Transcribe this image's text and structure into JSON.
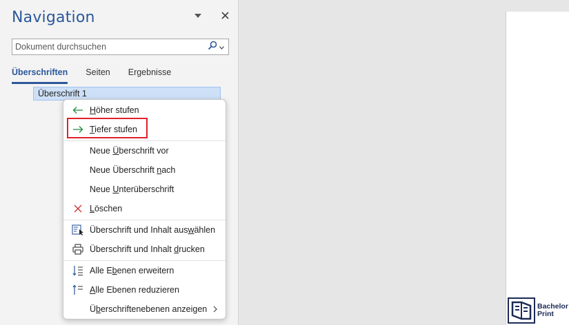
{
  "nav": {
    "title": "Navigation",
    "search_placeholder": "Dokument durchsuchen",
    "tabs": [
      {
        "label": "Überschriften",
        "active": true
      },
      {
        "label": "Seiten",
        "active": false
      },
      {
        "label": "Ergebnisse",
        "active": false
      }
    ],
    "selected_heading": "Überschrift 1"
  },
  "context_menu": {
    "items": [
      {
        "id": "promote",
        "icon": "arrow-left-icon",
        "pre": "",
        "key": "H",
        "post": "öher stufen"
      },
      {
        "id": "demote",
        "icon": "arrow-right-icon",
        "pre": "",
        "key": "T",
        "post": "iefer stufen"
      },
      {
        "id": "new-heading-before",
        "icon": "",
        "pre": "Neue ",
        "key": "Ü",
        "post": "berschrift vor"
      },
      {
        "id": "new-heading-after",
        "icon": "",
        "pre": "Neue Überschrift ",
        "key": "n",
        "post": "ach"
      },
      {
        "id": "new-subheading",
        "icon": "",
        "pre": "Neue ",
        "key": "U",
        "post": "nterüberschrift"
      },
      {
        "id": "delete",
        "icon": "delete-x-icon",
        "pre": "",
        "key": "L",
        "post": "öschen"
      },
      {
        "id": "select-heading-content",
        "icon": "select-content-icon",
        "pre": "Überschrift und Inhalt aus",
        "key": "w",
        "post": "ählen"
      },
      {
        "id": "print-heading-content",
        "icon": "printer-icon",
        "pre": "Überschrift und Inhalt ",
        "key": "d",
        "post": "rucken"
      },
      {
        "id": "expand-all",
        "icon": "expand-levels-icon",
        "pre": "Alle E",
        "key": "b",
        "post": "enen erweitern"
      },
      {
        "id": "collapse-all",
        "icon": "collapse-levels-icon",
        "pre": "",
        "key": "A",
        "post": "lle Ebenen reduzieren"
      },
      {
        "id": "show-heading-levels",
        "icon": "",
        "pre": "Ü",
        "key": "b",
        "post": "erschriftenebenen anzeigen"
      }
    ]
  },
  "watermark": {
    "line1": "Bachelor",
    "line2": "Print"
  },
  "colors": {
    "accent": "#2b579a",
    "highlight": "#e0202a",
    "green_arrow": "#1e8a3c",
    "red_x": "#d13438"
  }
}
